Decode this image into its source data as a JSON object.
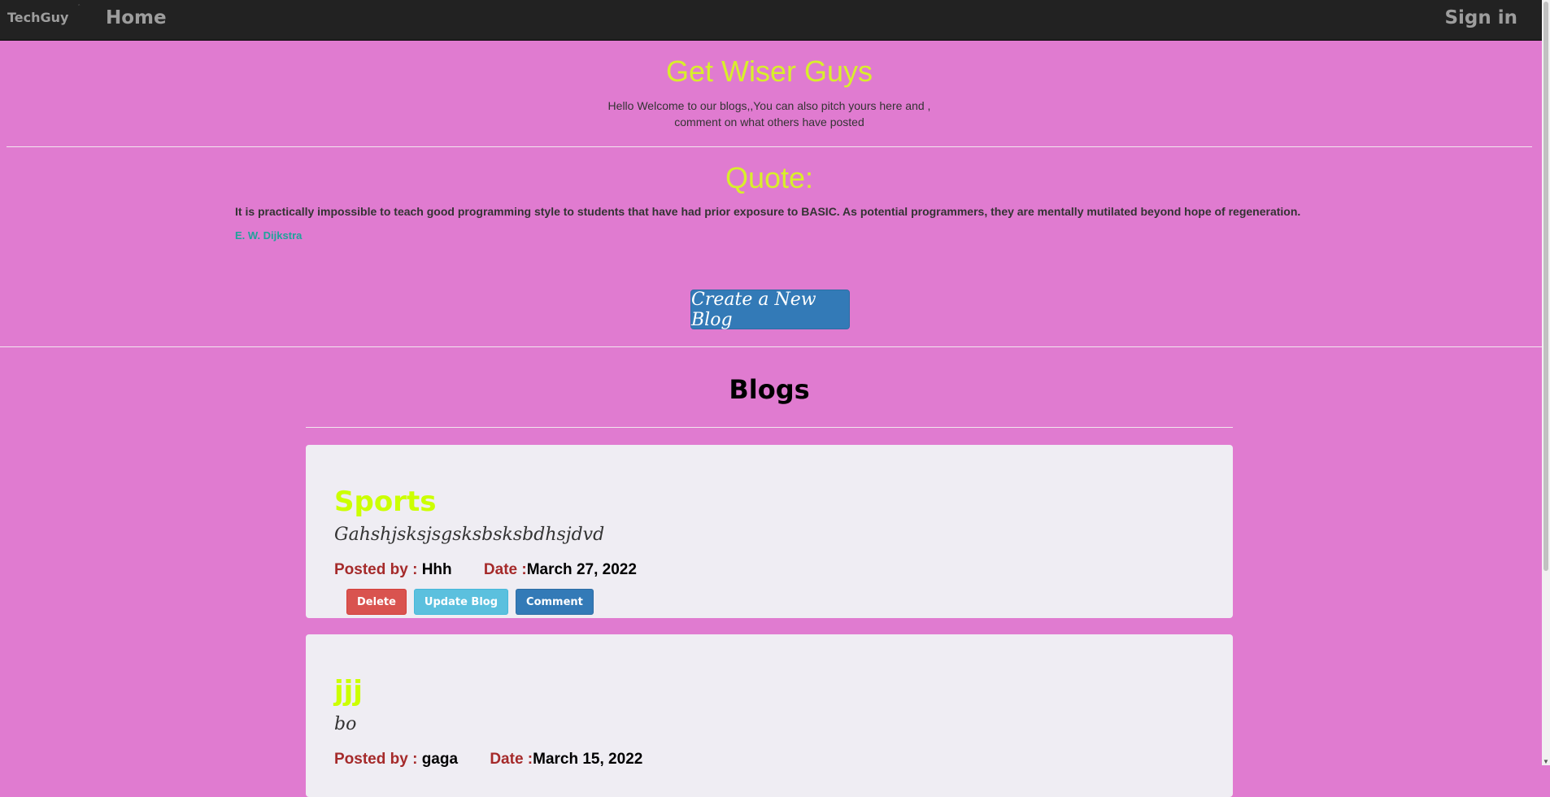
{
  "navbar": {
    "brand": "TechGuy",
    "brand_mark": "ˆ",
    "home": "Home",
    "signin": "Sign in"
  },
  "header": {
    "title": "Get Wiser Guys",
    "intro": "Hello Welcome to our blogs,,You can also pitch yours here and , comment on what others have posted"
  },
  "quote": {
    "heading": "Quote:",
    "text": "It is practically impossible to teach good programming style to students that have had prior exposure to BASIC. As potential programmers, they are mentally mutilated beyond hope of regeneration.",
    "author": "E. W. Dijkstra"
  },
  "create_button": "Create a New Blog",
  "blogs_heading": "Blogs",
  "labels": {
    "posted_by": "Posted by : ",
    "date": "Date :"
  },
  "blogs": [
    {
      "title": "Sports",
      "body": "Gahshjsksjsgsksbsksbdhsjdvd",
      "author": "Hhh",
      "date": "March 27, 2022",
      "buttons": {
        "delete": "Delete",
        "update": "Update Blog",
        "comment": "Comment"
      }
    },
    {
      "title": "jjj",
      "body": "bo",
      "author": "gaga",
      "date": "March 15, 2022"
    }
  ],
  "colors": {
    "background": "#e07bd0",
    "title_accent": "#d8ef2b",
    "blog_title": "#ccff00",
    "meta_label": "#a52a2a",
    "author": "#1fa39a"
  }
}
